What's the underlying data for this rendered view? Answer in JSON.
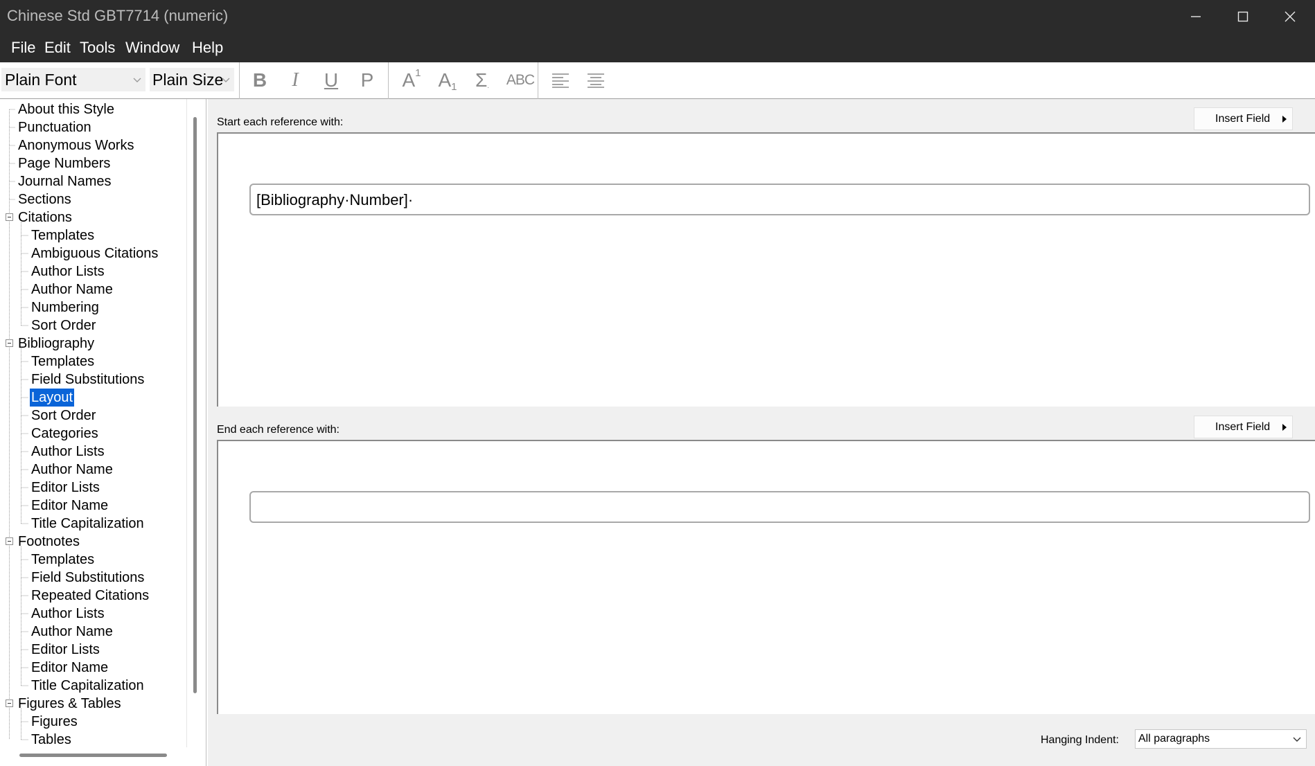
{
  "window": {
    "title": "Chinese Std GBT7714 (numeric)",
    "controls": [
      "minimize-icon",
      "maximize-icon",
      "close-icon"
    ]
  },
  "menu": {
    "file": "File",
    "edit": "Edit",
    "tools": "Tools",
    "window": "Window",
    "help": "Help"
  },
  "toolbar": {
    "font": "Plain Font",
    "size": "Plain Size",
    "bold": "B",
    "italic": "I",
    "underline": "U",
    "plain": "P",
    "superscript": "A",
    "subscript": "A",
    "sup_digit": "1",
    "sub_digit": "1",
    "symbol": "Σ",
    "smallcaps": "ABC",
    "align_icons": [
      "align-left-icon",
      "align-center-icon"
    ]
  },
  "tree": {
    "items": [
      {
        "label": "About this Style"
      },
      {
        "label": "Punctuation"
      },
      {
        "label": "Anonymous Works"
      },
      {
        "label": "Page Numbers"
      },
      {
        "label": "Journal Names"
      },
      {
        "label": "Sections"
      },
      {
        "label": "Citations"
      },
      {
        "label": "Templates"
      },
      {
        "label": "Ambiguous Citations"
      },
      {
        "label": "Author Lists"
      },
      {
        "label": "Author Name"
      },
      {
        "label": "Numbering"
      },
      {
        "label": "Sort Order"
      },
      {
        "label": "Bibliography"
      },
      {
        "label": "Templates"
      },
      {
        "label": "Field Substitutions"
      },
      {
        "label": "Layout"
      },
      {
        "label": "Sort Order"
      },
      {
        "label": "Categories"
      },
      {
        "label": "Author Lists"
      },
      {
        "label": "Author Name"
      },
      {
        "label": "Editor Lists"
      },
      {
        "label": "Editor Name"
      },
      {
        "label": "Title Capitalization"
      },
      {
        "label": "Footnotes"
      },
      {
        "label": "Templates"
      },
      {
        "label": "Field Substitutions"
      },
      {
        "label": "Repeated Citations"
      },
      {
        "label": "Author Lists"
      },
      {
        "label": "Author Name"
      },
      {
        "label": "Editor Lists"
      },
      {
        "label": "Editor Name"
      },
      {
        "label": "Title Capitalization"
      },
      {
        "label": "Figures & Tables"
      },
      {
        "label": "Figures"
      },
      {
        "label": "Tables"
      }
    ],
    "selected": "Layout"
  },
  "layout": {
    "start_label": "Start each reference with:",
    "start_value": "[Bibliography·Number]·",
    "end_label": "End each reference with:",
    "end_value": "",
    "insert_field": "Insert Field",
    "hanging_indent_label": "Hanging Indent:",
    "hanging_indent_value": "All paragraphs"
  }
}
